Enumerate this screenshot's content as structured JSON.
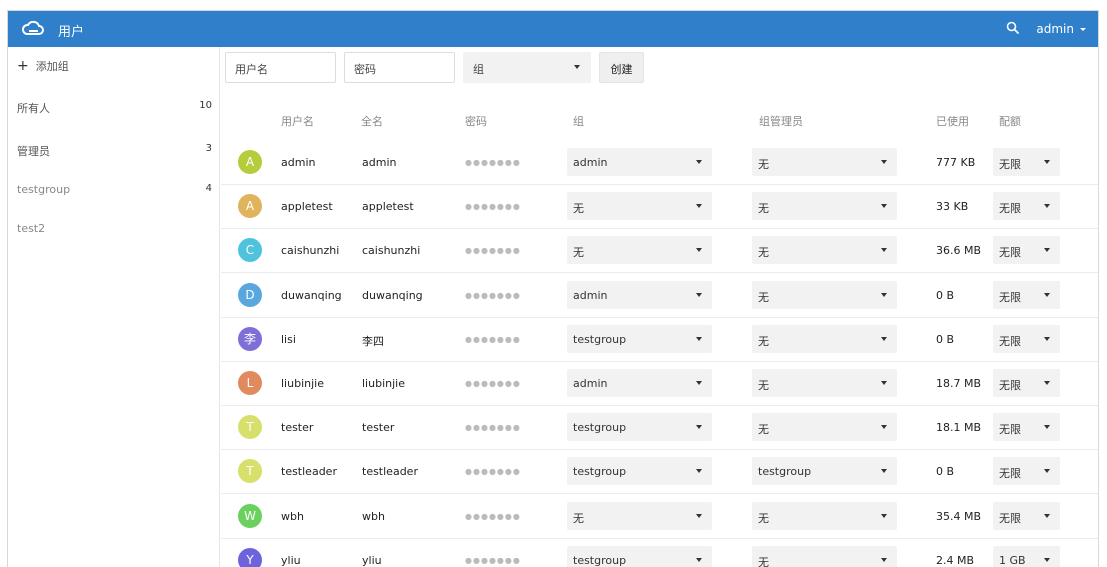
{
  "app": {
    "title": "用户",
    "user_menu": "admin"
  },
  "sidebar": {
    "add_group": "添加组",
    "groups": [
      {
        "name": "所有人",
        "count": "10"
      },
      {
        "name": "管理员",
        "count": "3"
      },
      {
        "name": "testgroup",
        "count": "4"
      },
      {
        "name": "test2",
        "count": ""
      }
    ]
  },
  "new_user": {
    "username_placeholder": "用户名",
    "password_placeholder": "密码",
    "group_select": "组",
    "create_label": "创建"
  },
  "table": {
    "headers": [
      "用户名",
      "全名",
      "密码",
      "组",
      "组管理员",
      "已使用",
      "配额"
    ],
    "password_mask": "●●●●●●●",
    "rows": [
      {
        "initial": "A",
        "color": "#b5cc3c",
        "username": "admin",
        "fullname": "admin",
        "group": "admin",
        "group_admin": "无",
        "used": "777 KB",
        "quota": "无限"
      },
      {
        "initial": "A",
        "color": "#e0b45c",
        "username": "appletest",
        "fullname": "appletest",
        "group": "无",
        "group_admin": "无",
        "used": "33 KB",
        "quota": "无限"
      },
      {
        "initial": "C",
        "color": "#4fc3dd",
        "username": "caishunzhi",
        "fullname": "caishunzhi",
        "group": "无",
        "group_admin": "无",
        "used": "36.6 MB",
        "quota": "无限"
      },
      {
        "initial": "D",
        "color": "#5aa7e0",
        "username": "duwanqing",
        "fullname": "duwanqing",
        "group": "admin",
        "group_admin": "无",
        "used": "0 B",
        "quota": "无限"
      },
      {
        "initial": "李",
        "color": "#7e6fd8",
        "username": "lisi",
        "fullname": "李四",
        "group": "testgroup",
        "group_admin": "无",
        "used": "0 B",
        "quota": "无限"
      },
      {
        "initial": "L",
        "color": "#e08a5e",
        "username": "liubinjie",
        "fullname": "liubinjie",
        "group": "admin",
        "group_admin": "无",
        "used": "18.7 MB",
        "quota": "无限"
      },
      {
        "initial": "T",
        "color": "#d7e06a",
        "username": "tester",
        "fullname": "tester",
        "group": "testgroup",
        "group_admin": "无",
        "used": "18.1 MB",
        "quota": "无限"
      },
      {
        "initial": "T",
        "color": "#d7e06a",
        "username": "testleader",
        "fullname": "testleader",
        "group": "testgroup",
        "group_admin": "testgroup",
        "used": "0 B",
        "quota": "无限"
      },
      {
        "initial": "W",
        "color": "#6bd15e",
        "username": "wbh",
        "fullname": "wbh",
        "group": "无",
        "group_admin": "无",
        "used": "35.4 MB",
        "quota": "无限"
      },
      {
        "initial": "Y",
        "color": "#6d63dd",
        "username": "yliu",
        "fullname": "yliu",
        "group": "testgroup",
        "group_admin": "无",
        "used": "2.4 MB",
        "quota": "1 GB"
      }
    ]
  }
}
